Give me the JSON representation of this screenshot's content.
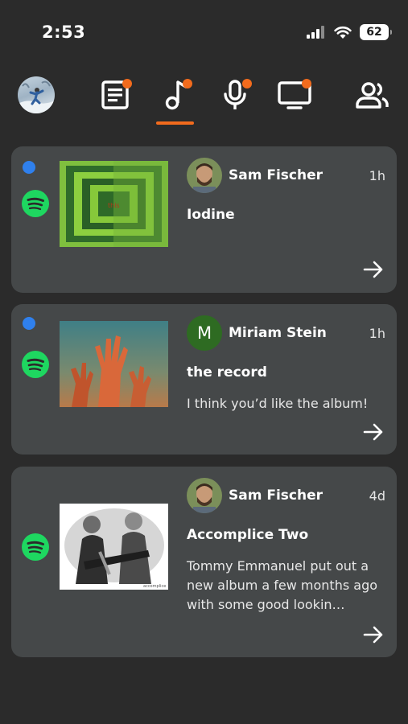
{
  "status": {
    "time": "2:53",
    "battery": "62"
  },
  "colors": {
    "accent": "#f26b1d",
    "unread": "#2f80ed",
    "spotify": "#1ed760",
    "card": "#454849",
    "background": "#2b2b2b"
  },
  "nav": {
    "icons": [
      "profile-avatar",
      "news-icon",
      "music-icon",
      "microphone-icon",
      "tv-icon",
      "people-icon"
    ],
    "active": "music-icon"
  },
  "feed": [
    {
      "sender": "Sam Fischer",
      "time": "1h",
      "title": "Iodine",
      "message": "",
      "unread": true,
      "service": "spotify-icon"
    },
    {
      "sender": "Miriam Stein",
      "sender_initial": "M",
      "time": "1h",
      "title": "the record",
      "message": "I think you’d like the album!",
      "unread": true,
      "service": "spotify-icon"
    },
    {
      "sender": "Sam Fischer",
      "time": "4d",
      "title": "Accomplice Two",
      "message": "Tommy Emmanuel put out a new album a few months ago with some good lookin…",
      "unread": false,
      "service": "spotify-icon"
    }
  ]
}
